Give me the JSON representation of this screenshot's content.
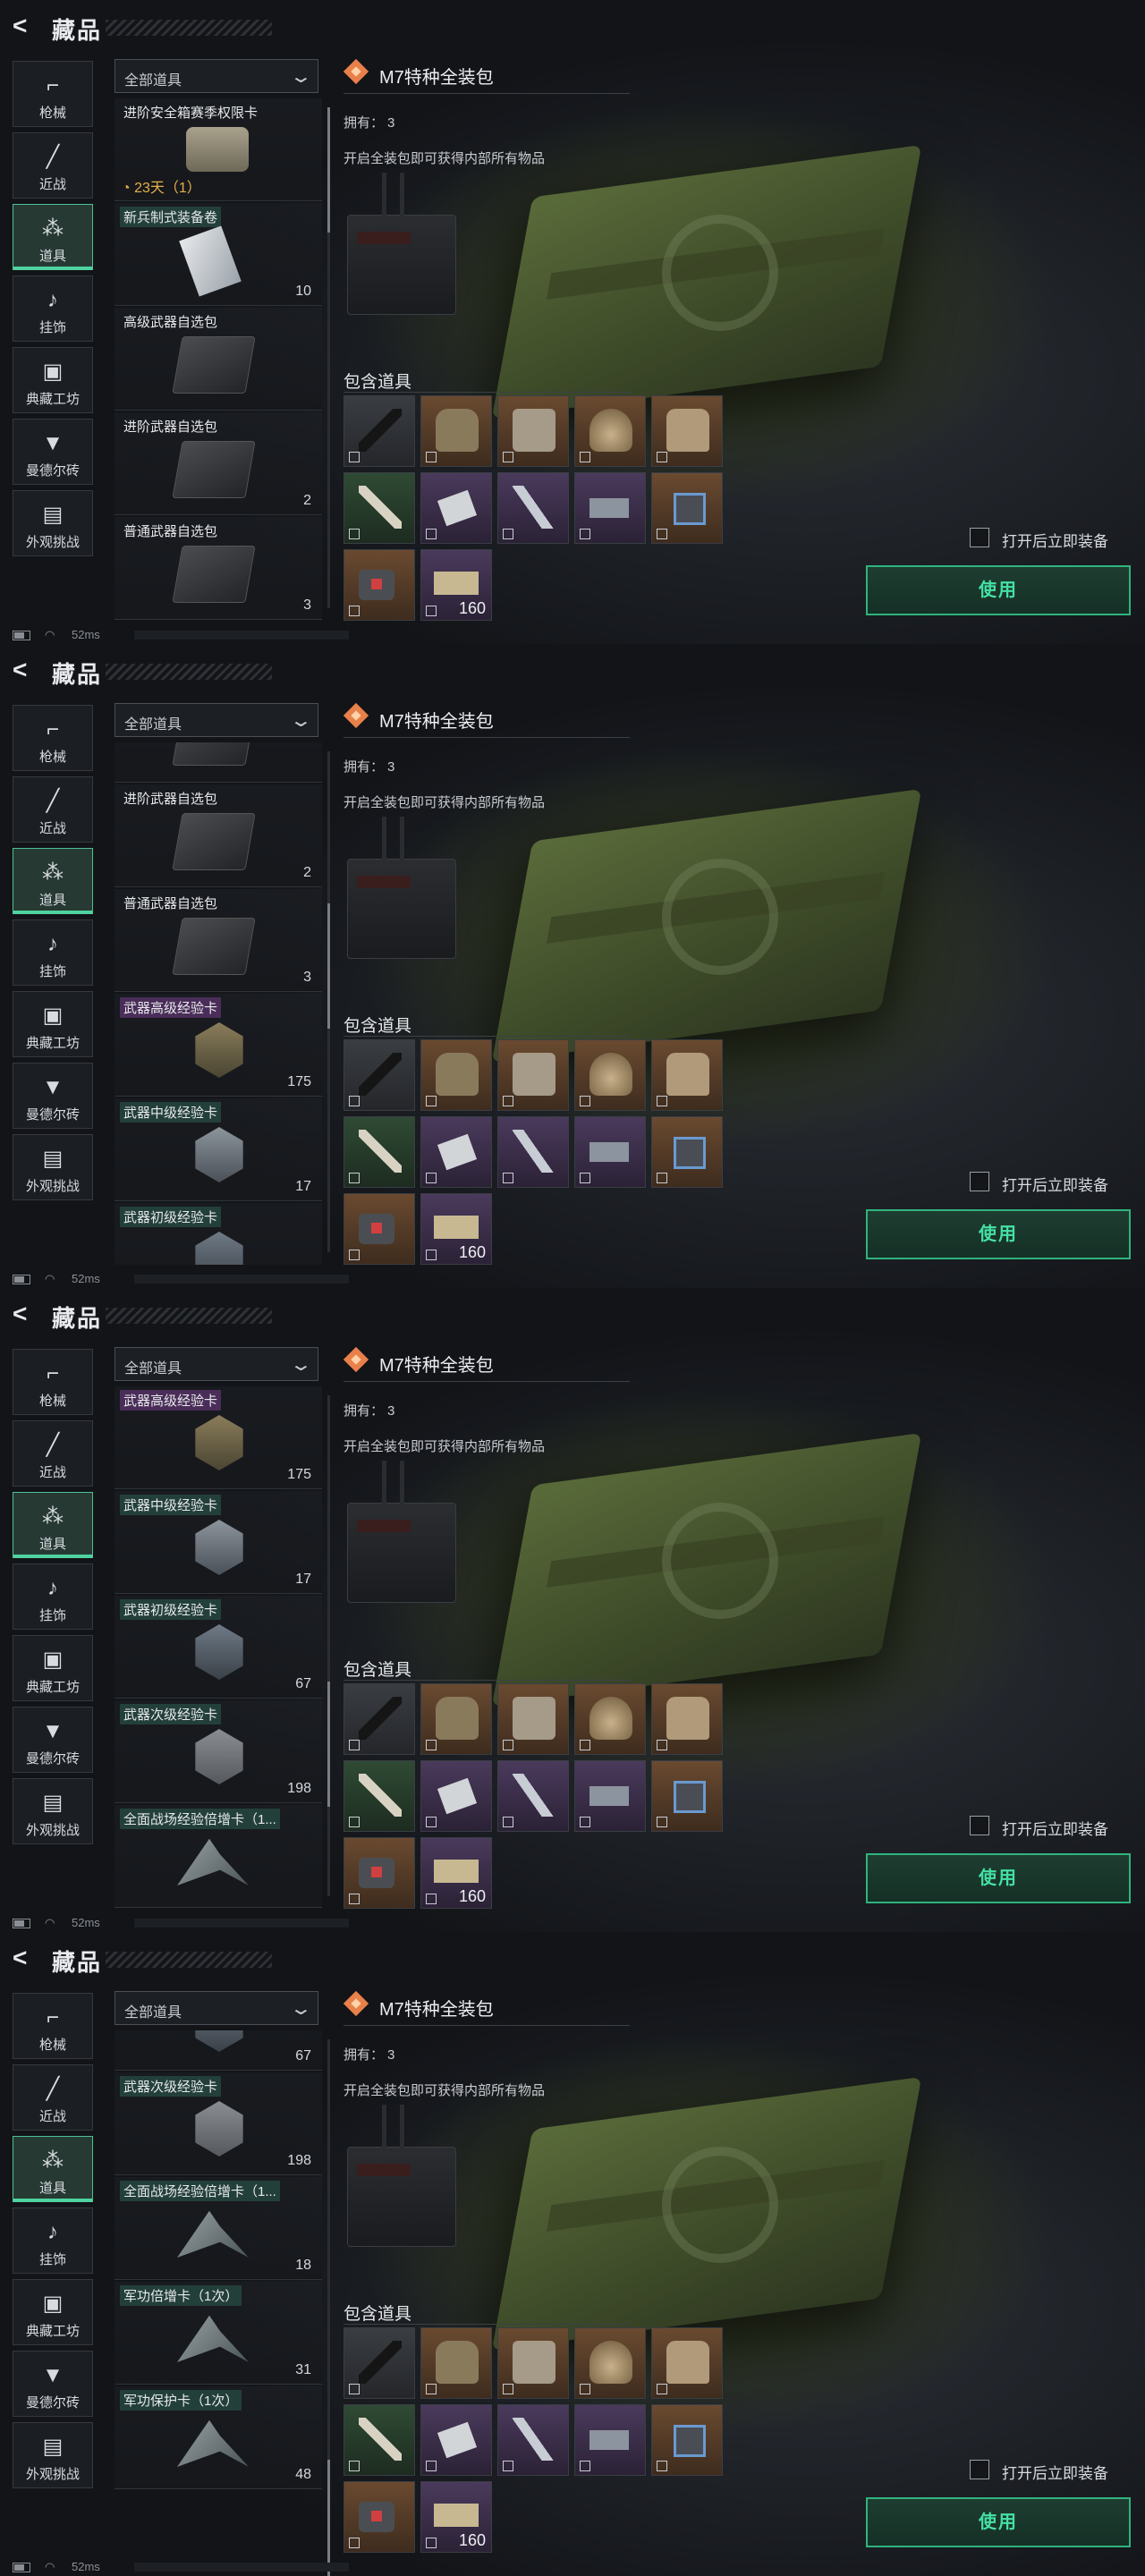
{
  "app": {
    "title": "藏品",
    "back_icon": "back-arrow-icon"
  },
  "sidebar": {
    "items": [
      {
        "label": "枪械",
        "icon": "pistol-icon"
      },
      {
        "label": "近战",
        "icon": "knife-icon"
      },
      {
        "label": "道具",
        "icon": "items-icon",
        "active": true
      },
      {
        "label": "挂饰",
        "icon": "charm-icon"
      },
      {
        "label": "典藏工坊",
        "icon": "workshop-icon"
      },
      {
        "label": "曼德尔砖",
        "icon": "brick-icon"
      },
      {
        "label": "外观挑战",
        "icon": "challenge-icon"
      }
    ]
  },
  "filter": {
    "label": "全部道具"
  },
  "detail": {
    "title": "M7特种全装包",
    "owned_label": "拥有：",
    "owned_value": "3",
    "description": "开启全装包即可获得内部所有物品",
    "contains_label": "包含道具",
    "contents": [
      {
        "name": "rifle",
        "count": ""
      },
      {
        "name": "vest",
        "count": ""
      },
      {
        "name": "chest-rig",
        "count": ""
      },
      {
        "name": "helmet",
        "count": ""
      },
      {
        "name": "armor-plate",
        "count": ""
      },
      {
        "name": "syringe",
        "count": ""
      },
      {
        "name": "dog-tag",
        "count": ""
      },
      {
        "name": "knife",
        "count": ""
      },
      {
        "name": "keycard",
        "count": ""
      },
      {
        "name": "device-box",
        "count": ""
      },
      {
        "name": "medkit",
        "count": ""
      },
      {
        "name": "ammo",
        "count": "160"
      }
    ],
    "auto_equip_label": "打开后立即装备",
    "use_label": "使用"
  },
  "status": {
    "ping": "52ms"
  },
  "frames": [
    {
      "items": [
        {
          "name": "进阶安全箱赛季权限卡",
          "tag": "none",
          "pic": "case",
          "count": "",
          "timer": "23天（1）"
        },
        {
          "name": "新兵制式装备卷",
          "tag": "green",
          "pic": "card",
          "count": "10",
          "timer": ""
        },
        {
          "name": "高级武器自选包",
          "tag": "none",
          "pic": "bag",
          "count": "",
          "timer": ""
        },
        {
          "name": "进阶武器自选包",
          "tag": "none",
          "pic": "bag",
          "count": "2",
          "timer": ""
        },
        {
          "name": "普通武器自选包",
          "tag": "none",
          "pic": "bag",
          "count": "3",
          "timer": ""
        }
      ]
    },
    {
      "items": [
        {
          "name": "",
          "tag": "none",
          "pic": "bag",
          "count": "",
          "timer": ""
        },
        {
          "name": "进阶武器自选包",
          "tag": "none",
          "pic": "bag",
          "count": "2",
          "timer": ""
        },
        {
          "name": "普通武器自选包",
          "tag": "none",
          "pic": "bag",
          "count": "3",
          "timer": ""
        },
        {
          "name": "武器高级经验卡",
          "tag": "purple",
          "pic": "hex-gold",
          "count": "175",
          "timer": ""
        },
        {
          "name": "武器中级经验卡",
          "tag": "green",
          "pic": "hex-silver",
          "count": "17",
          "timer": ""
        },
        {
          "name": "武器初级经验卡",
          "tag": "green",
          "pic": "hex-steel",
          "count": "",
          "timer": ""
        }
      ]
    },
    {
      "items": [
        {
          "name": "武器高级经验卡",
          "tag": "purple",
          "pic": "hex-gold",
          "count": "175",
          "timer": ""
        },
        {
          "name": "武器中级经验卡",
          "tag": "green",
          "pic": "hex-silver",
          "count": "17",
          "timer": ""
        },
        {
          "name": "武器初级经验卡",
          "tag": "green",
          "pic": "hex-steel",
          "count": "67",
          "timer": ""
        },
        {
          "name": "武器次级经验卡",
          "tag": "green",
          "pic": "hex-gray",
          "count": "198",
          "timer": ""
        },
        {
          "name": "全面战场经验倍增卡（1...",
          "tag": "green",
          "pic": "wing",
          "count": "",
          "timer": ""
        }
      ]
    },
    {
      "items": [
        {
          "name": "",
          "tag": "none",
          "pic": "hex-steel",
          "count": "67",
          "timer": ""
        },
        {
          "name": "武器次级经验卡",
          "tag": "green",
          "pic": "hex-gray",
          "count": "198",
          "timer": ""
        },
        {
          "name": "全面战场经验倍增卡（1...",
          "tag": "green",
          "pic": "wing",
          "count": "18",
          "timer": ""
        },
        {
          "name": "军功倍增卡（1次）",
          "tag": "green",
          "pic": "wing",
          "count": "31",
          "timer": ""
        },
        {
          "name": "军功保护卡（1次）",
          "tag": "green",
          "pic": "wing",
          "count": "48",
          "timer": ""
        }
      ]
    }
  ]
}
